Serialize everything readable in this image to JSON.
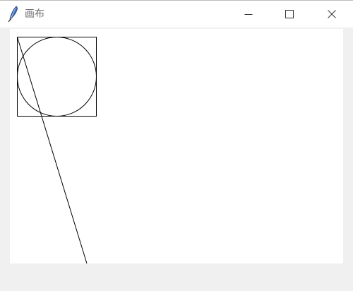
{
  "window": {
    "title": "画布",
    "app_icon": "feather-icon",
    "controls": {
      "minimize_icon": "minimize-icon",
      "maximize_icon": "maximize-icon",
      "close_icon": "close-icon"
    }
  },
  "canvas": {
    "background": "#ffffff",
    "stroke_color": "#000000",
    "shapes": [
      "rectangle",
      "circle",
      "line"
    ]
  }
}
